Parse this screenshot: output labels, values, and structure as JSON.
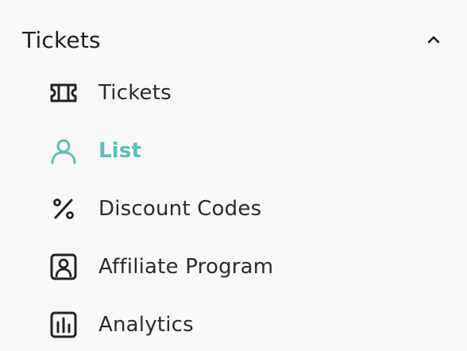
{
  "section": {
    "title": "Tickets",
    "expanded": true,
    "chevron_icon": "chevron-up-icon"
  },
  "colors": {
    "active_accent": "#5bbdb7",
    "text": "#2b2b2b",
    "background": "#f8f8f8"
  },
  "items": [
    {
      "label": "Tickets",
      "icon": "ticket-icon",
      "active": false
    },
    {
      "label": "List",
      "icon": "user-icon",
      "active": true
    },
    {
      "label": "Discount Codes",
      "icon": "percent-icon",
      "active": false
    },
    {
      "label": "Affiliate Program",
      "icon": "contact-card-icon",
      "active": false
    },
    {
      "label": "Analytics",
      "icon": "bar-chart-icon",
      "active": false
    }
  ]
}
